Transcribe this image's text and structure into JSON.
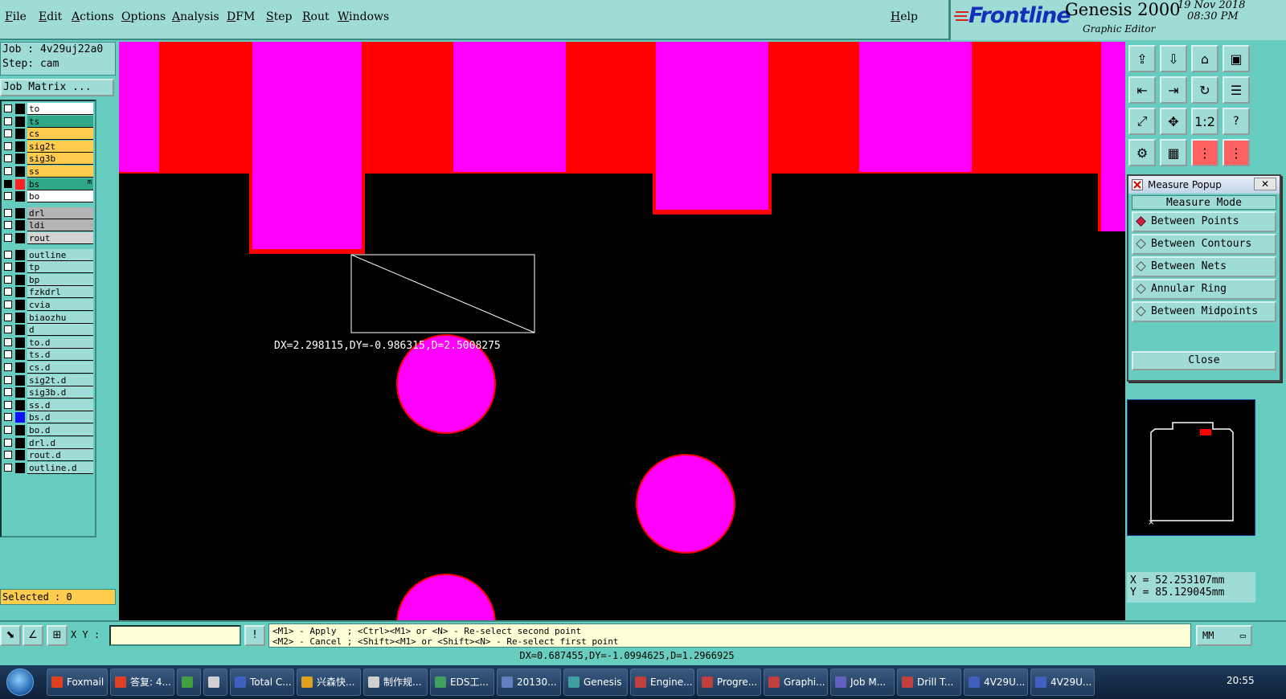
{
  "menubar": {
    "items": [
      "File",
      "Edit",
      "Actions",
      "Options",
      "Analysis",
      "DFM",
      "Step",
      "Rout",
      "Windows"
    ],
    "help": "Help"
  },
  "branding": {
    "logo": "Frontline",
    "product": "Genesis 2000",
    "subtitle": "Graphic Editor",
    "date": "19 Nov 2018",
    "time": "08:30 PM"
  },
  "job": {
    "job_line": "Job : 4v29uj22a0",
    "step_line": "Step: cam",
    "matrix_button": "Job Matrix ..."
  },
  "layers": [
    {
      "name": "to",
      "bg": "#ffffff",
      "swatch": "#000000"
    },
    {
      "name": "ts",
      "bg": "#2ea886",
      "swatch": "#000000"
    },
    {
      "name": "cs",
      "bg": "#ffcc4d",
      "swatch": "#000000"
    },
    {
      "name": "sig2t",
      "bg": "#ffcc4d",
      "swatch": "#000000"
    },
    {
      "name": "sig3b",
      "bg": "#ffcc4d",
      "swatch": "#000000"
    },
    {
      "name": "ss",
      "bg": "#ffcc4d",
      "swatch": "#000000"
    },
    {
      "name": "bs",
      "bg": "#2ea886",
      "swatch": "#ff2020",
      "checked": true,
      "marker": "m"
    },
    {
      "name": "bo",
      "bg": "#ffffff",
      "swatch": "#000000"
    },
    {
      "name": "drl",
      "bg": "#b4b4b4",
      "swatch": "#000000",
      "gap": true
    },
    {
      "name": "ldi",
      "bg": "#b4b4b4",
      "swatch": "#000000"
    },
    {
      "name": "rout",
      "bg": "#d4d4d4",
      "swatch": "#000000"
    },
    {
      "name": "outline",
      "bg": "#9fdcd6",
      "swatch": "#000000",
      "gap": true
    },
    {
      "name": "tp",
      "bg": "#9fdcd6",
      "swatch": "#000000"
    },
    {
      "name": "bp",
      "bg": "#9fdcd6",
      "swatch": "#000000"
    },
    {
      "name": "fzkdrl",
      "bg": "#9fdcd6",
      "swatch": "#000000"
    },
    {
      "name": "cvia",
      "bg": "#9fdcd6",
      "swatch": "#000000"
    },
    {
      "name": "biaozhu",
      "bg": "#9fdcd6",
      "swatch": "#000000"
    },
    {
      "name": "d",
      "bg": "#9fdcd6",
      "swatch": "#000000"
    },
    {
      "name": "to.d",
      "bg": "#9fdcd6",
      "swatch": "#000000"
    },
    {
      "name": "ts.d",
      "bg": "#9fdcd6",
      "swatch": "#000000"
    },
    {
      "name": "cs.d",
      "bg": "#9fdcd6",
      "swatch": "#000000"
    },
    {
      "name": "sig2t.d",
      "bg": "#9fdcd6",
      "swatch": "#000000"
    },
    {
      "name": "sig3b.d",
      "bg": "#9fdcd6",
      "swatch": "#000000"
    },
    {
      "name": "ss.d",
      "bg": "#9fdcd6",
      "swatch": "#000000"
    },
    {
      "name": "bs.d",
      "bg": "#9fdcd6",
      "swatch": "#1010ff"
    },
    {
      "name": "bo.d",
      "bg": "#9fdcd6",
      "swatch": "#000000"
    },
    {
      "name": "drl.d",
      "bg": "#9fdcd6",
      "swatch": "#000000"
    },
    {
      "name": "rout.d",
      "bg": "#9fdcd6",
      "swatch": "#000000"
    },
    {
      "name": "outline.d",
      "bg": "#9fdcd6",
      "swatch": "#000000"
    }
  ],
  "selected_text": "Selected : 0",
  "canvas": {
    "measure_readout": "DX=2.298115,DY=-0.986315,D=2.5008275",
    "colors": {
      "copper": "#ff00ff",
      "mask": "#ff0000",
      "background": "#000000"
    }
  },
  "toolbar_icons": [
    "zoom-home-icon",
    "zoom-in-icon",
    "home-icon",
    "window-icon",
    "pan-left-icon",
    "pan-right-icon",
    "redraw-icon",
    "layers-icon",
    "fit-icon",
    "pan-icon",
    "scale-1-2-icon",
    "help-icon",
    "snap-icon",
    "grid-icon",
    "net-icon",
    "feature-icon"
  ],
  "measure_popup": {
    "title": "Measure Popup",
    "heading": "Measure Mode",
    "options": [
      "Between Points",
      "Between Contours",
      "Between Nets",
      "Annular Ring",
      "Between Midpoints"
    ],
    "selected": "Between Points",
    "close_label": "Close"
  },
  "coords": {
    "x": "X = 52.253107mm",
    "y": "Y = 85.129045mm"
  },
  "command": {
    "xy_label": "X Y :",
    "xy_value": "",
    "hint_line1": "<M1> - Apply  ; <Ctrl><M1> or <N> - Re-select second point",
    "hint_line2": "<M2> - Cancel ; <Shift><M1> or <Shift><N> - Re-select first point",
    "units": "MM"
  },
  "status_line": "DX=0.687455,DY=-1.0994625,D=1.2966925",
  "taskbar": {
    "tasks": [
      "Foxmail",
      "答复: 4...",
      "",
      "",
      "Total C...",
      "兴森快...",
      "制作规...",
      "EDS工...",
      "20130...",
      "Genesis",
      "Engine...",
      "Progre...",
      "Graphi...",
      "Job M...",
      "Drill T...",
      "4V29U...",
      "4V29U..."
    ],
    "clock": "20:55"
  }
}
